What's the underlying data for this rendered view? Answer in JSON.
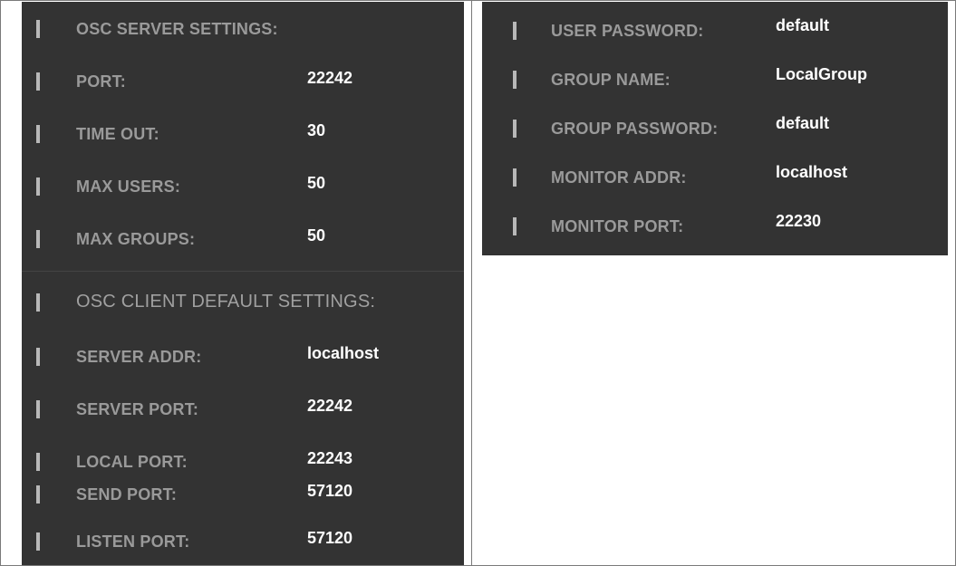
{
  "server": {
    "heading": "OSC SERVER SETTINGS:",
    "rows": [
      {
        "label": "PORT:",
        "value": "22242"
      },
      {
        "label": "TIME OUT:",
        "value": "30"
      },
      {
        "label": "MAX USERS:",
        "value": "50"
      },
      {
        "label": "MAX GROUPS:",
        "value": "50"
      }
    ]
  },
  "client": {
    "heading": "OSC CLIENT DEFAULT SETTINGS:",
    "rows": [
      {
        "label": "SERVER ADDR:",
        "value": "localhost"
      },
      {
        "label": "SERVER PORT:",
        "value": "22242"
      },
      {
        "label": "LOCAL PORT:",
        "value": "22243"
      },
      {
        "label": "SEND PORT:",
        "value": "57120"
      },
      {
        "label": "LISTEN PORT:",
        "value": "57120"
      }
    ]
  },
  "client_continued": {
    "rows": [
      {
        "label": "USER PASSWORD:",
        "value": "default"
      },
      {
        "label": "GROUP NAME:",
        "value": "LocalGroup"
      },
      {
        "label": "GROUP PASSWORD:",
        "value": "default"
      },
      {
        "label": "MONITOR ADDR:",
        "value": "localhost"
      },
      {
        "label": "MONITOR PORT:",
        "value": "22230"
      }
    ]
  },
  "colors": {
    "panel_bg": "#333333",
    "label": "#9a9a9a",
    "value": "#ffffff",
    "bar": "#b8b8b8"
  }
}
